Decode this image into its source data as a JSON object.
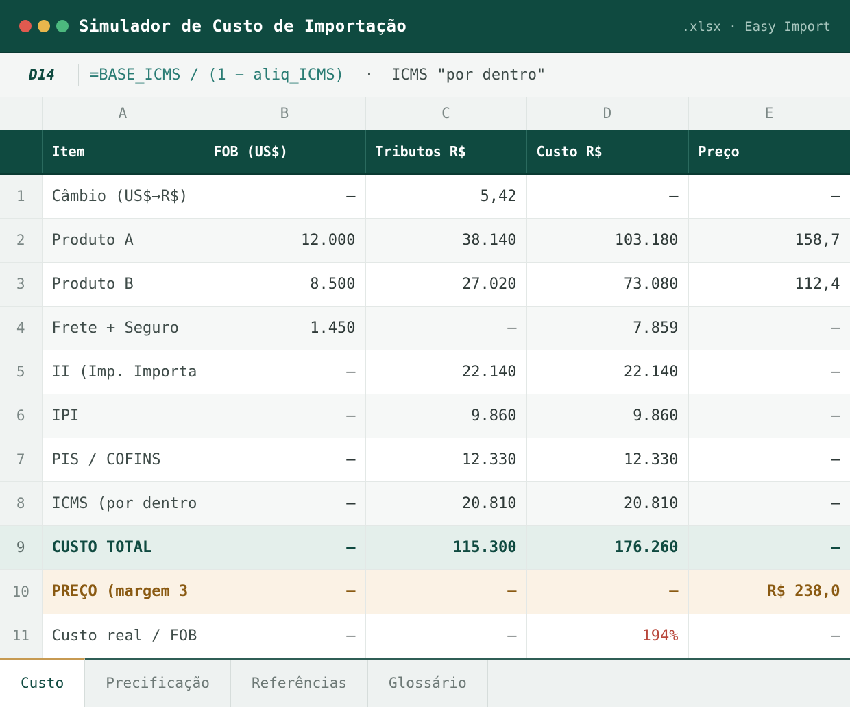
{
  "window": {
    "title": "Simulador de Custo de Importação",
    "right_label": ".xlsx · Easy Import",
    "dot_colors": [
      "#e05a4f",
      "#e8b64c",
      "#4cb87e"
    ]
  },
  "formula_bar": {
    "cell_ref": "D14",
    "formula": "=BASE_ICMS / (1 − aliq_ICMS)",
    "separator": "·",
    "note": "ICMS \"por dentro\""
  },
  "columns": [
    "A",
    "B",
    "C",
    "D",
    "E"
  ],
  "headers": [
    "Item",
    "FOB (US$)",
    "Tributos R$",
    "Custo R$",
    "Preço"
  ],
  "rows": [
    {
      "n": "1",
      "cells": [
        "Câmbio (US$→R$)",
        "—",
        "5,42",
        "—",
        "—"
      ]
    },
    {
      "n": "2",
      "cells": [
        "Produto A",
        "12.000",
        "38.140",
        "103.180",
        "158,7"
      ]
    },
    {
      "n": "3",
      "cells": [
        "Produto B",
        "8.500",
        "27.020",
        "73.080",
        "112,4"
      ]
    },
    {
      "n": "4",
      "cells": [
        "Frete + Seguro",
        "1.450",
        "—",
        "7.859",
        "—"
      ]
    },
    {
      "n": "5",
      "cells": [
        "II (Imp. Importa",
        "—",
        "22.140",
        "22.140",
        "—"
      ]
    },
    {
      "n": "6",
      "cells": [
        "IPI",
        "—",
        "9.860",
        "9.860",
        "—"
      ]
    },
    {
      "n": "7",
      "cells": [
        "PIS / COFINS",
        "—",
        "12.330",
        "12.330",
        "—"
      ]
    },
    {
      "n": "8",
      "cells": [
        "ICMS (por dentro",
        "—",
        "20.810",
        "20.810",
        "—"
      ]
    },
    {
      "n": "9",
      "cells": [
        "CUSTO TOTAL",
        "—",
        "115.300",
        "176.260",
        "—"
      ]
    },
    {
      "n": "10",
      "cells": [
        "PREÇO (margem 3",
        "—",
        "—",
        "—",
        "R$ 238,0"
      ]
    },
    {
      "n": "11",
      "cells": [
        "Custo real / FOB",
        "—",
        "—",
        "194%",
        "—"
      ]
    }
  ],
  "sheet_tabs": [
    {
      "label": "Custo",
      "active": true
    },
    {
      "label": "Precificação",
      "active": false
    },
    {
      "label": "Referências",
      "active": false
    },
    {
      "label": "Glossário",
      "active": false
    }
  ],
  "colors": {
    "header_bg": "#0f4a40",
    "total_bg": "#e4efeb",
    "price_bg": "#fbf2e5",
    "price_text": "#8a5a12",
    "alert_text": "#b8473b",
    "active_tab_accent": "#c79a52"
  }
}
